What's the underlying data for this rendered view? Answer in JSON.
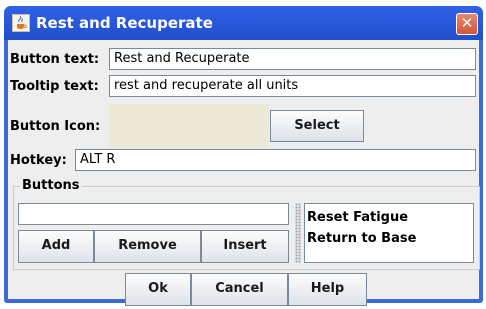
{
  "window": {
    "title": "Rest and Recuperate"
  },
  "form": {
    "button_text_label": "Button text:",
    "button_text_value": "Rest and Recuperate",
    "tooltip_text_label": "Tooltip text:",
    "tooltip_text_value": "rest and recuperate all units",
    "button_icon_label": "Button Icon:",
    "select_label": "Select",
    "hotkey_label": "Hotkey:",
    "hotkey_value": "ALT R"
  },
  "buttons_group": {
    "title": "Buttons",
    "input_value": "",
    "add_label": "Add",
    "remove_label": "Remove",
    "insert_label": "Insert",
    "items": [
      "Reset Fatigue",
      "Return to Base"
    ]
  },
  "footer": {
    "ok_label": "Ok",
    "cancel_label": "Cancel",
    "help_label": "Help"
  }
}
